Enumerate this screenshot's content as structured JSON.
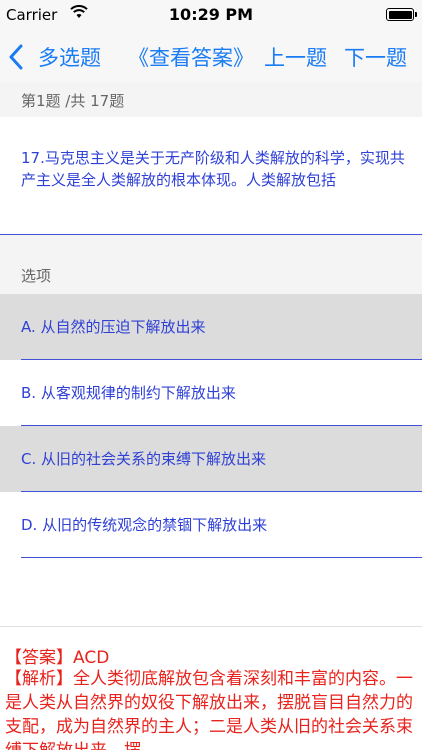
{
  "status_bar": {
    "carrier": "Carrier",
    "time": "10:29 PM"
  },
  "nav": {
    "back_label": "多选题",
    "view_answer": "《查看答案》",
    "prev": "上一题",
    "next": "下一题"
  },
  "counter": "第1题 /共 17题",
  "question": "17.马克思主义是关于无产阶级和人类解放的科学，实现共产主义是全人类解放的根本体现。人类解放包括",
  "options_label": "选项",
  "options": [
    {
      "label": "A.  从自然的压迫下解放出来",
      "selected": true
    },
    {
      "label": "B.  从客观规律的制约下解放出来",
      "selected": false
    },
    {
      "label": "C.  从旧的社会关系的束缚下解放出来",
      "selected": true
    },
    {
      "label": "D.  从旧的传统观念的禁锢下解放出来",
      "selected": false
    }
  ],
  "answer": "【答案】ACD",
  "analysis": "【解析】全人类彻底解放包含着深刻和丰富的内容。一是人类从自然界的奴役下解放出来，摆脱盲目自然力的支配，成为自然界的主人；二是人类从旧的社会关系束缚下解放出来，摆",
  "colors": {
    "accent": "#1a7cf5",
    "question_text": "#2f40d6",
    "answer_text": "#e8231d",
    "selected_bg": "#dcdcdc"
  },
  "icons": {
    "back": "chevron-left-icon",
    "wifi": "wifi-icon",
    "battery": "battery-icon"
  }
}
